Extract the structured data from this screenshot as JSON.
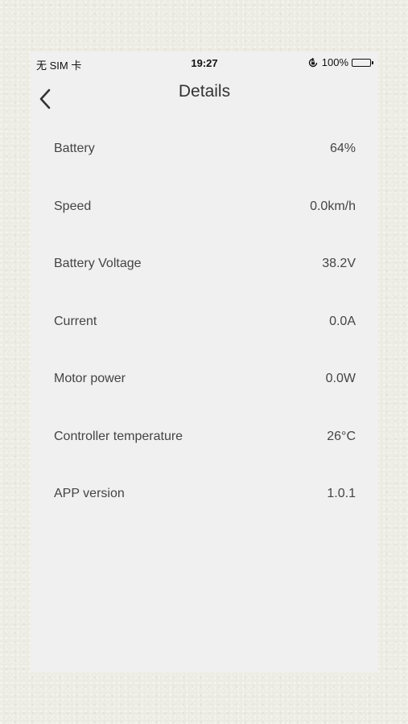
{
  "status_bar": {
    "carrier": "无 SIM 卡",
    "time": "19:27",
    "battery_percent": "100%",
    "icons": [
      "orientation-lock-icon",
      "battery-icon"
    ]
  },
  "nav": {
    "title": "Details",
    "back_icon": "chevron-left-icon"
  },
  "details": [
    {
      "label": "Battery",
      "value": "64%"
    },
    {
      "label": "Speed",
      "value": "0.0km/h"
    },
    {
      "label": "Battery Voltage",
      "value": "38.2V"
    },
    {
      "label": "Current",
      "value": "0.0A"
    },
    {
      "label": "Motor power",
      "value": "0.0W"
    },
    {
      "label": "Controller temperature",
      "value": "26°C"
    },
    {
      "label": "APP version",
      "value": "1.0.1"
    }
  ],
  "colors": {
    "page_background": "#ecebe2",
    "screen_background": "#f0f0f0",
    "text": "#444444"
  }
}
